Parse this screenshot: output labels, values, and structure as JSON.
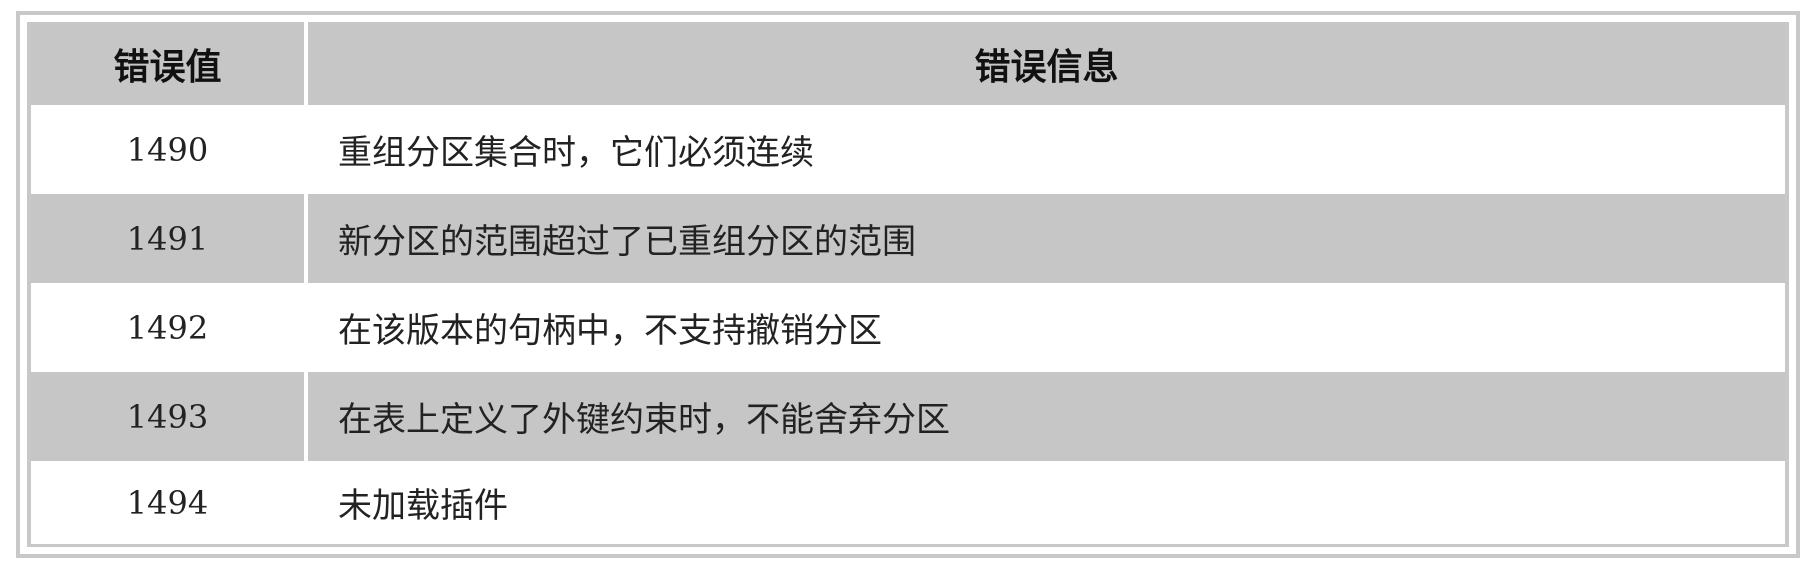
{
  "table": {
    "headers": {
      "code": "错误值",
      "message": "错误信息"
    },
    "rows": [
      {
        "code": "1490",
        "message": "重组分区集合时，它们必须连续"
      },
      {
        "code": "1491",
        "message": "新分区的范围超过了已重组分区的范围"
      },
      {
        "code": "1492",
        "message": "在该版本的句柄中，不支持撤销分区"
      },
      {
        "code": "1493",
        "message": "在表上定义了外键约束时，不能舍弃分区"
      },
      {
        "code": "1494",
        "message": "未加载插件"
      }
    ]
  },
  "colors": {
    "header_bg": "#c6c6c6",
    "stripe_bg": "#c6c6c6",
    "row_bg": "#ffffff",
    "border": "#c8c8c8"
  }
}
